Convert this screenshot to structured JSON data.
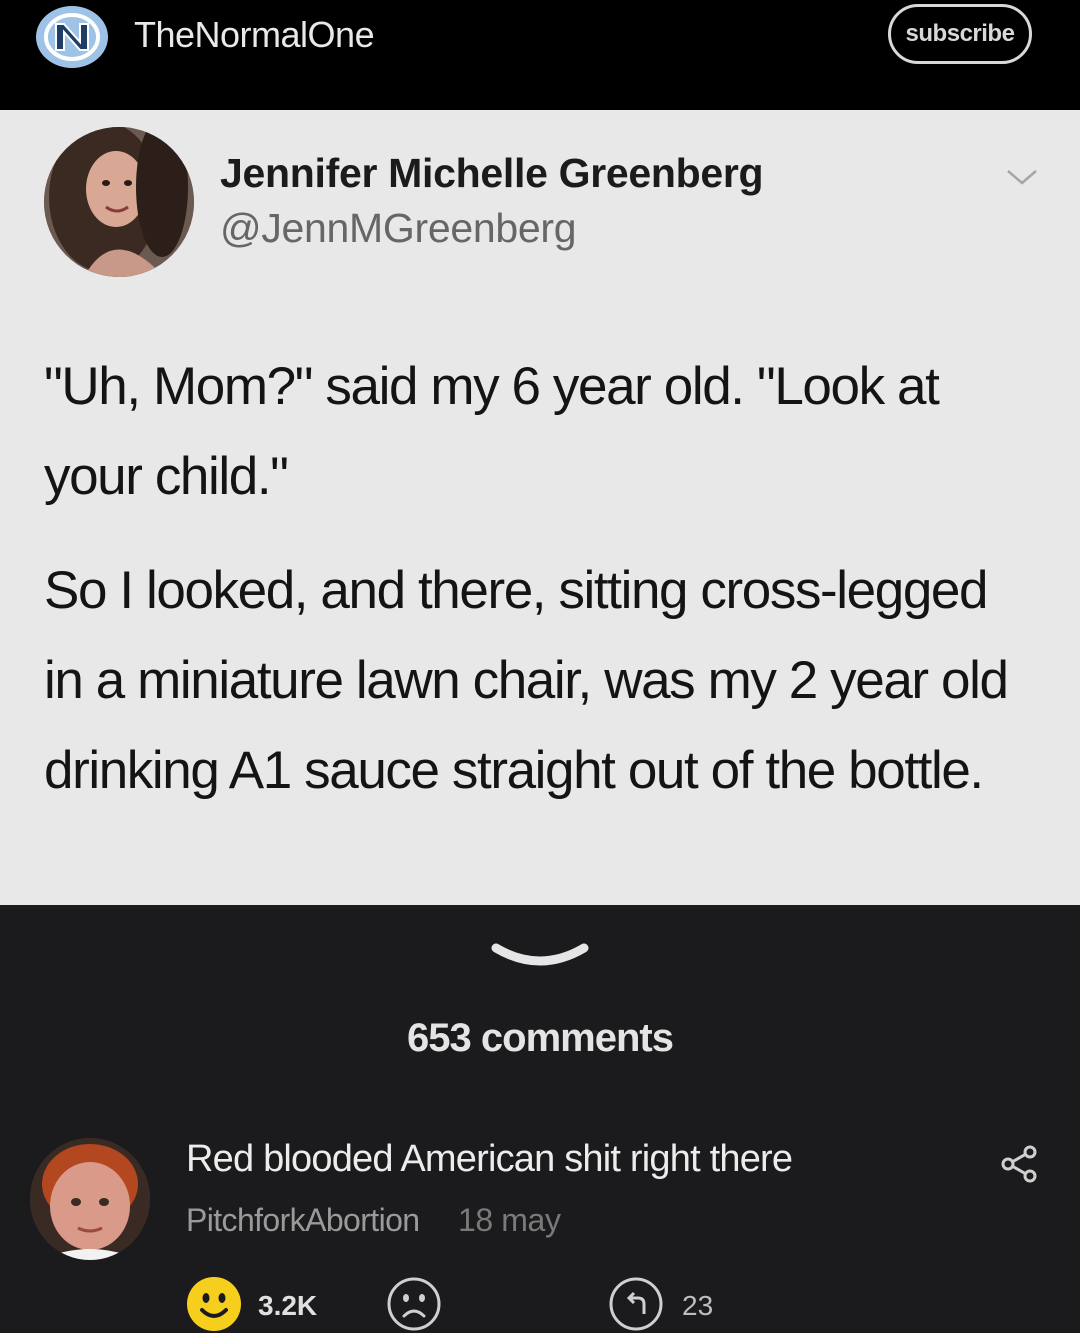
{
  "header": {
    "channel_logo_icon": "unc-logo-icon",
    "channel_name": "TheNormalOne",
    "subscribe_label": "subscribe"
  },
  "tweet": {
    "author_name": "Jennifer Michelle Greenberg",
    "author_handle": "@JennMGreenberg",
    "menu_icon": "chevron-down-icon",
    "paragraphs": [
      "\"Uh, Mom?\" said my 6 year old. \"Look at your child.\"",
      "So I looked, and there, sitting cross-legged in a miniature lawn chair, was my 2 year old drinking A1 sauce straight out of the bottle."
    ]
  },
  "post": {
    "collapse_icon": "chevron-down-icon",
    "comments_count": "653 comments"
  },
  "comment": {
    "text": "Red blooded American shit right there",
    "username": "PitchforkAbortion",
    "time": "18 may",
    "share_icon": "share-icon",
    "like_icon": "smiley-face-icon",
    "like_count": "3.2K",
    "dislike_icon": "sad-face-icon",
    "reply_icon": "reply-icon",
    "reply_count": "23"
  },
  "colors": {
    "background": "#1b1b1d",
    "header_background": "#000000",
    "tweet_background": "#e8e8e8",
    "like_yellow": "#f6cf1e"
  }
}
